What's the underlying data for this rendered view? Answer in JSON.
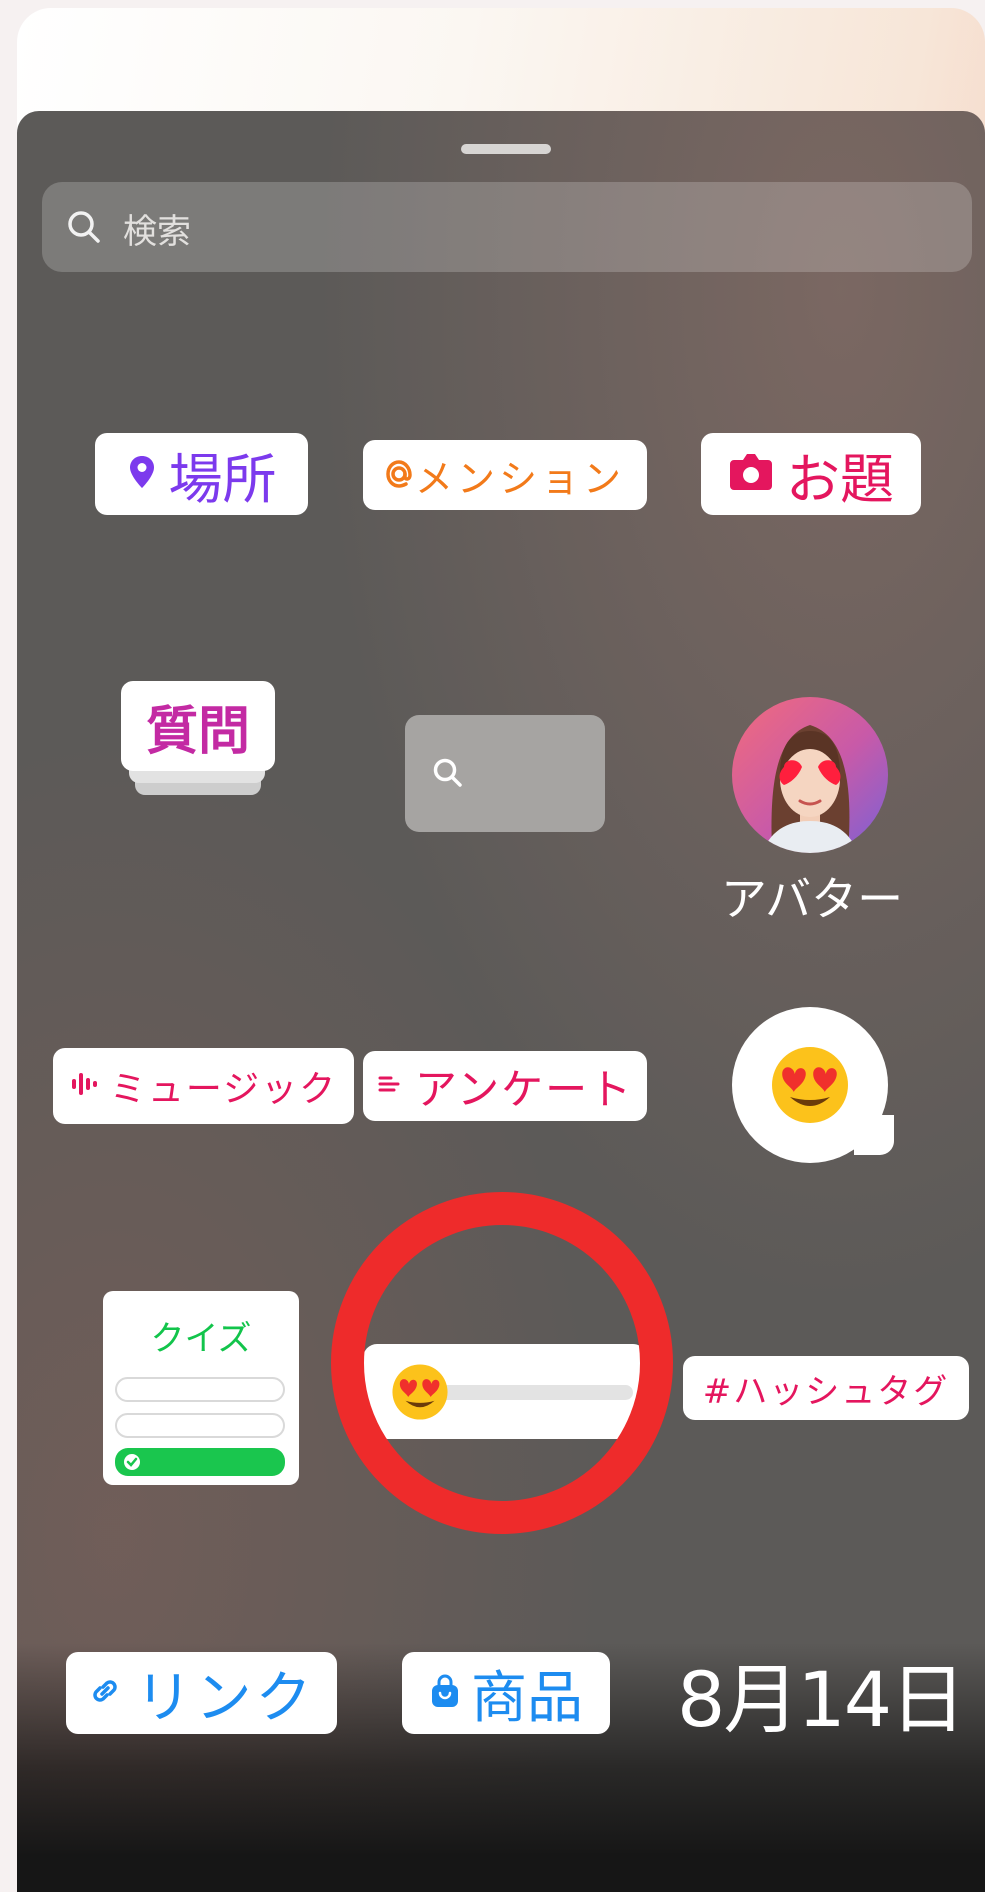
{
  "search": {
    "placeholder": "検索"
  },
  "stickers": {
    "location": {
      "label": "場所",
      "color": "#7c3aed"
    },
    "mention": {
      "label": "メンション",
      "color": "#f27a1a"
    },
    "prompt": {
      "label": "お題",
      "color": "#e4165e"
    },
    "questions": {
      "label": "質問",
      "color": "#c32aa3"
    },
    "avatar": {
      "label": "アバター"
    },
    "music": {
      "label": "ミュージック",
      "color": "#e4165e"
    },
    "poll": {
      "label": "アンケート",
      "color": "#e4165e"
    },
    "quiz": {
      "label": "クイズ",
      "color": "#12c44b"
    },
    "hashtag": {
      "label": "#ハッシュタグ",
      "color": "#e4165e"
    },
    "link": {
      "label": "リンク",
      "color": "#1d8cf0"
    },
    "product": {
      "label": "商品",
      "color": "#1d8cf0"
    },
    "date": {
      "label": "8月14日"
    }
  },
  "highlight": {
    "color": "#ee2b2b",
    "target": "emoji-slider-sticker"
  }
}
